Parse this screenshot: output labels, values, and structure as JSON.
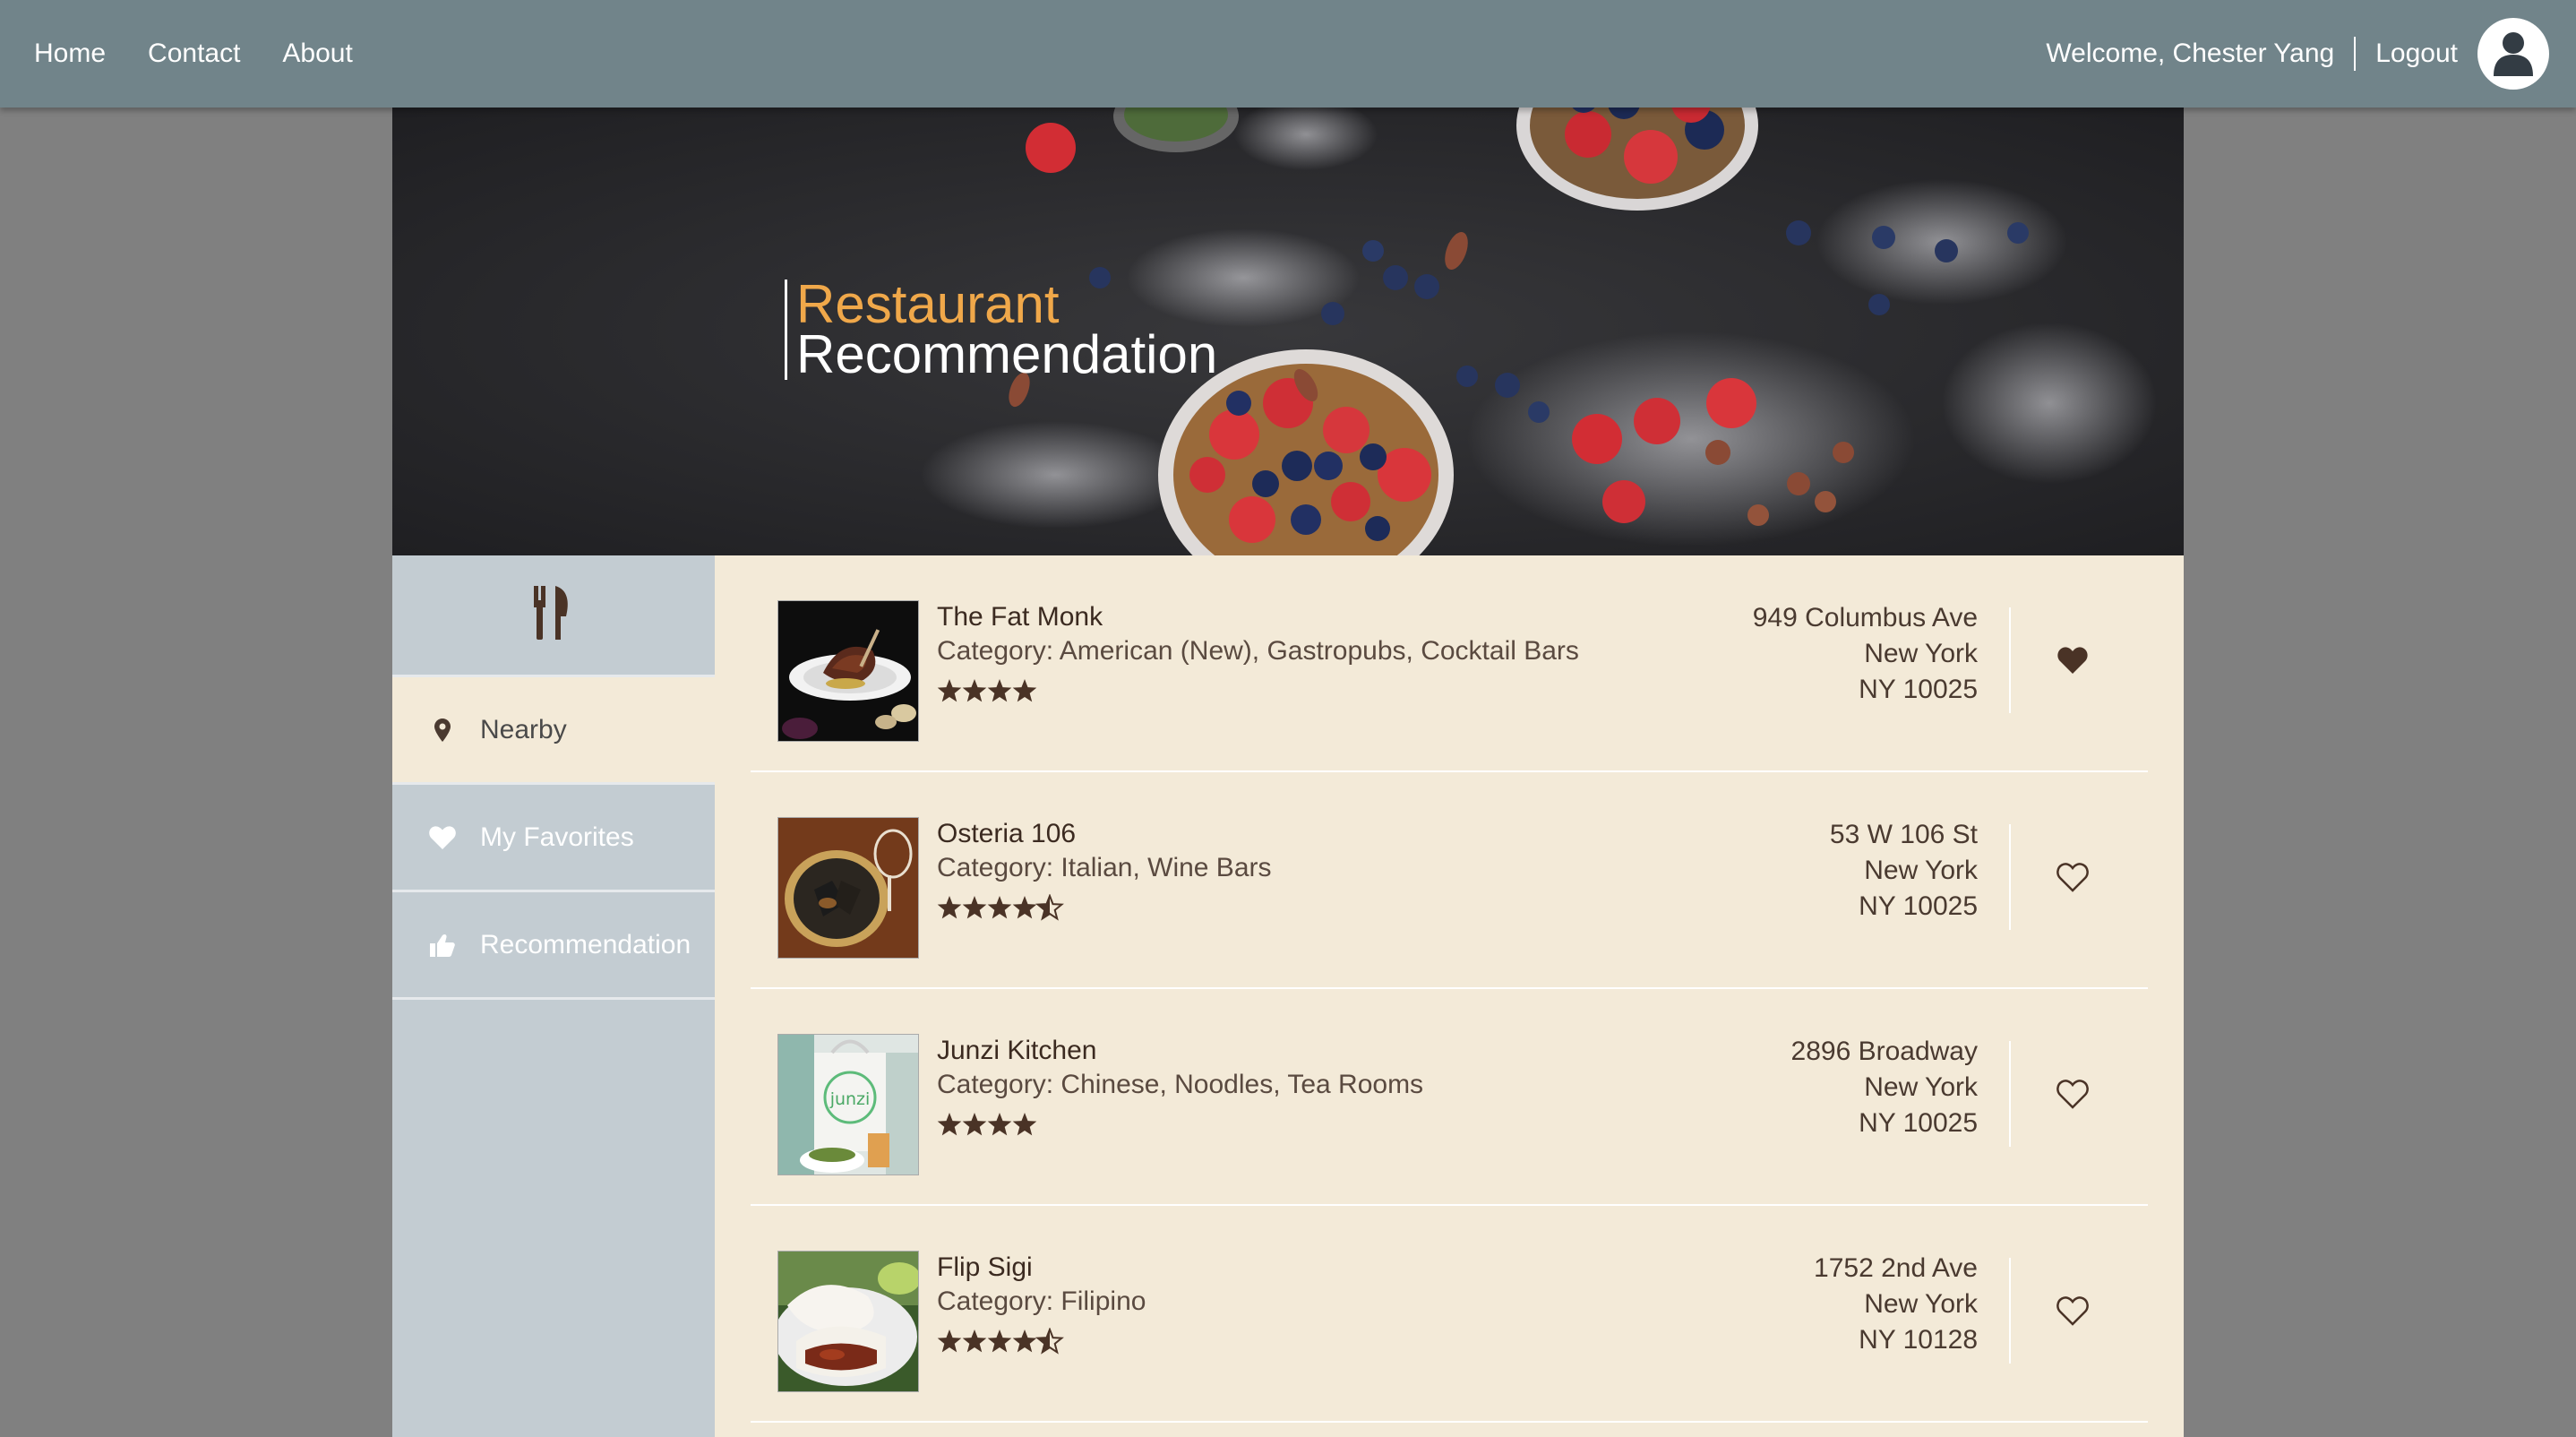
{
  "nav": {
    "links": [
      "Home",
      "Contact",
      "About"
    ],
    "welcome": "Welcome, Chester Yang",
    "logout": "Logout",
    "avatar_icon": "user-avatar-icon"
  },
  "hero": {
    "title_line1": "Restaurant",
    "title_line2": "Recommendation"
  },
  "sidebar": {
    "header_icon": "fork-knife-icon",
    "items": [
      {
        "label": "Nearby",
        "icon": "map-pin-icon",
        "active": true
      },
      {
        "label": "My Favorites",
        "icon": "heart-icon",
        "active": false
      },
      {
        "label": "Recommendation",
        "icon": "thumbs-up-icon",
        "active": false
      }
    ]
  },
  "restaurants": [
    {
      "name": "The Fat Monk",
      "category": "Category: American (New), Gastropubs, Cocktail Bars",
      "rating": 4,
      "address": [
        "949 Columbus Ave",
        "New York",
        "NY 10025"
      ],
      "favorite": true
    },
    {
      "name": "Osteria 106",
      "category": "Category: Italian, Wine Bars",
      "rating": 4.5,
      "address": [
        "53 W 106 St",
        "New York",
        "NY 10025"
      ],
      "favorite": false
    },
    {
      "name": "Junzi Kitchen",
      "category": "Category: Chinese, Noodles, Tea Rooms",
      "rating": 4,
      "address": [
        "2896 Broadway",
        "New York",
        "NY 10025"
      ],
      "favorite": false,
      "thumb_text": "junzi"
    },
    {
      "name": "Flip Sigi",
      "category": "Category: Filipino",
      "rating": 4.5,
      "address": [
        "1752 2nd Ave",
        "New York",
        "NY 10128"
      ],
      "favorite": false
    }
  ],
  "colors": {
    "nav_bg": "#71848a",
    "accent": "#f0a84a",
    "sidebar_bg": "#c3ccd2",
    "content_bg": "#f3ead8",
    "star": "#4a3326"
  }
}
